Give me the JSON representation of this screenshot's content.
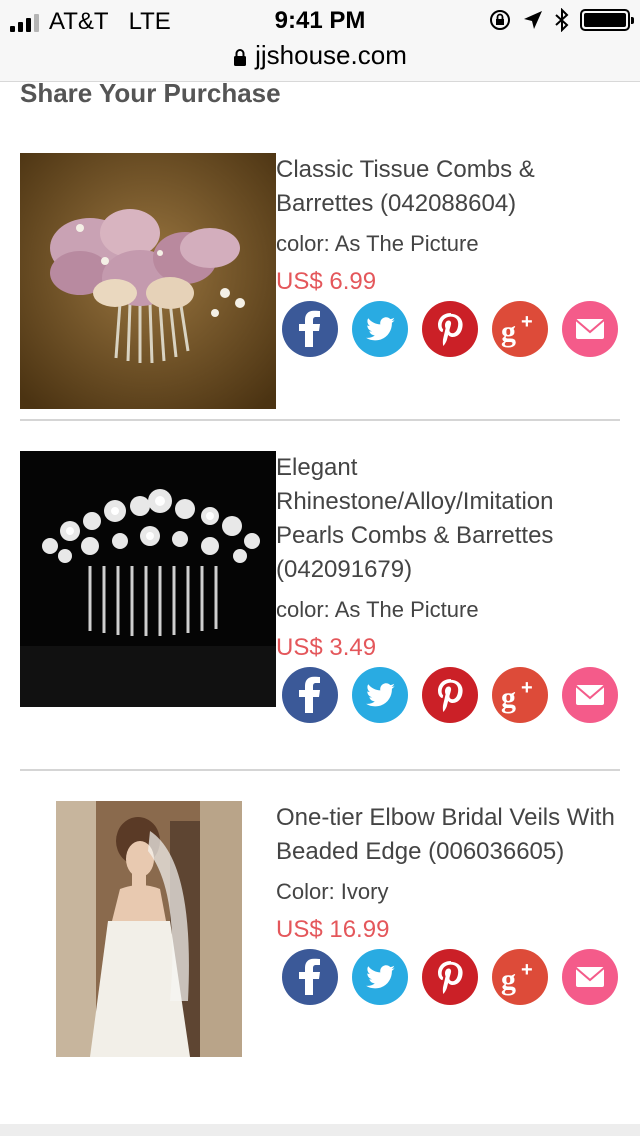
{
  "status_bar": {
    "carrier": "AT&T",
    "network": "LTE",
    "time": "9:41 PM"
  },
  "browser": {
    "url": "jjshouse.com"
  },
  "section_title": "Share Your Purchase",
  "products": [
    {
      "name": "Classic Tissue Combs & Barrettes (042088604)",
      "color_line": "color: As The Picture",
      "price": "US$ 6.99",
      "image": "floral-hair-comb-image"
    },
    {
      "name": "Elegant Rhinestone/Alloy/Imitation Pearls Combs & Barrettes (042091679)",
      "color_line": "color: As The Picture",
      "price": "US$ 3.49",
      "image": "rhinestone-hair-comb-image"
    },
    {
      "name": "One-tier Elbow Bridal Veils With Beaded Edge (006036605)",
      "color_line": "Color: Ivory",
      "price": "US$ 16.99",
      "image": "bridal-veil-model-image"
    }
  ],
  "share_icons": [
    {
      "name": "facebook-icon",
      "color": "#3b5998"
    },
    {
      "name": "twitter-icon",
      "color": "#29abe2"
    },
    {
      "name": "pinterest-icon",
      "color": "#cb2027"
    },
    {
      "name": "google-plus-icon",
      "color": "#dd4b39"
    },
    {
      "name": "email-icon",
      "color": "#f45b8a"
    }
  ],
  "colors": {
    "price": "#e4575b",
    "divider": "#d5d5d5"
  }
}
